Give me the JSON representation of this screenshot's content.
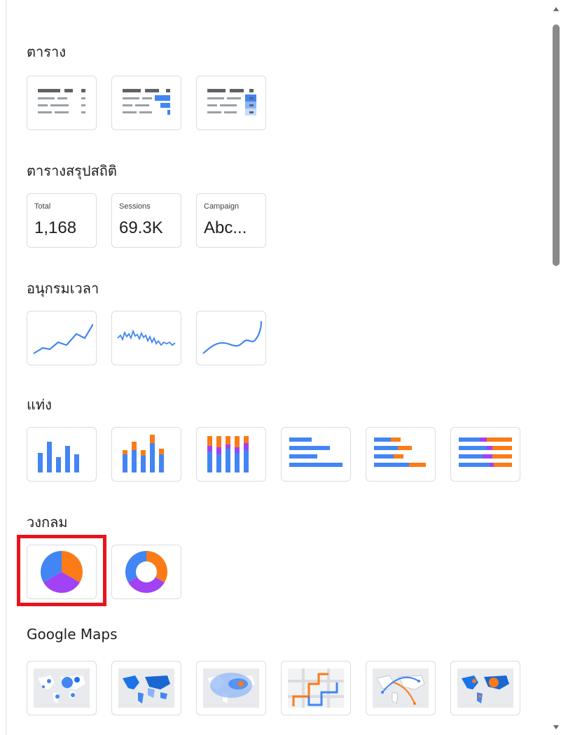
{
  "sections": {
    "table": {
      "title": "ตาราง"
    },
    "scorecard": {
      "title": "ตารางสรุปสถิติ",
      "cards": [
        {
          "label": "Total",
          "value": "1,168"
        },
        {
          "label": "Sessions",
          "value": "69.3K"
        },
        {
          "label": "Campaign",
          "value": "Abc..."
        }
      ]
    },
    "time_series": {
      "title": "อนุกรมเวลา"
    },
    "bar": {
      "title": "แท่ง"
    },
    "pie": {
      "title": "วงกลม",
      "selected": "pie-chart"
    },
    "geo": {
      "title": "Google Maps"
    }
  },
  "colors": {
    "blue": "#4285f4",
    "orange": "#fa7b17",
    "purple": "#a142f4",
    "selection": "#e8141d"
  }
}
